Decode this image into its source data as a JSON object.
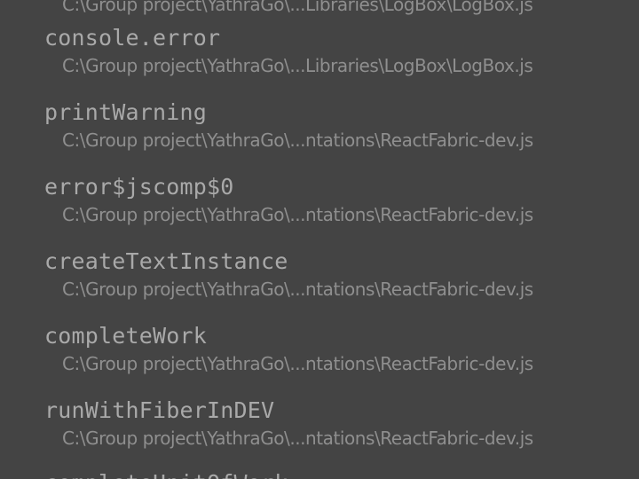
{
  "stack_frames": [
    {
      "function": "",
      "path": "C:\\Group project\\YathraGo\\...Libraries\\LogBox\\LogBox.js"
    },
    {
      "function": "console.error",
      "path": "C:\\Group project\\YathraGo\\...Libraries\\LogBox\\LogBox.js"
    },
    {
      "function": "printWarning",
      "path": "C:\\Group project\\YathraGo\\...ntations\\ReactFabric-dev.js"
    },
    {
      "function": "error$jscomp$0",
      "path": "C:\\Group project\\YathraGo\\...ntations\\ReactFabric-dev.js"
    },
    {
      "function": "createTextInstance",
      "path": "C:\\Group project\\YathraGo\\...ntations\\ReactFabric-dev.js"
    },
    {
      "function": "completeWork",
      "path": "C:\\Group project\\YathraGo\\...ntations\\ReactFabric-dev.js"
    },
    {
      "function": "runWithFiberInDEV",
      "path": "C:\\Group project\\YathraGo\\...ntations\\ReactFabric-dev.js"
    },
    {
      "function": "completeUnitOfWork",
      "path": ""
    }
  ]
}
